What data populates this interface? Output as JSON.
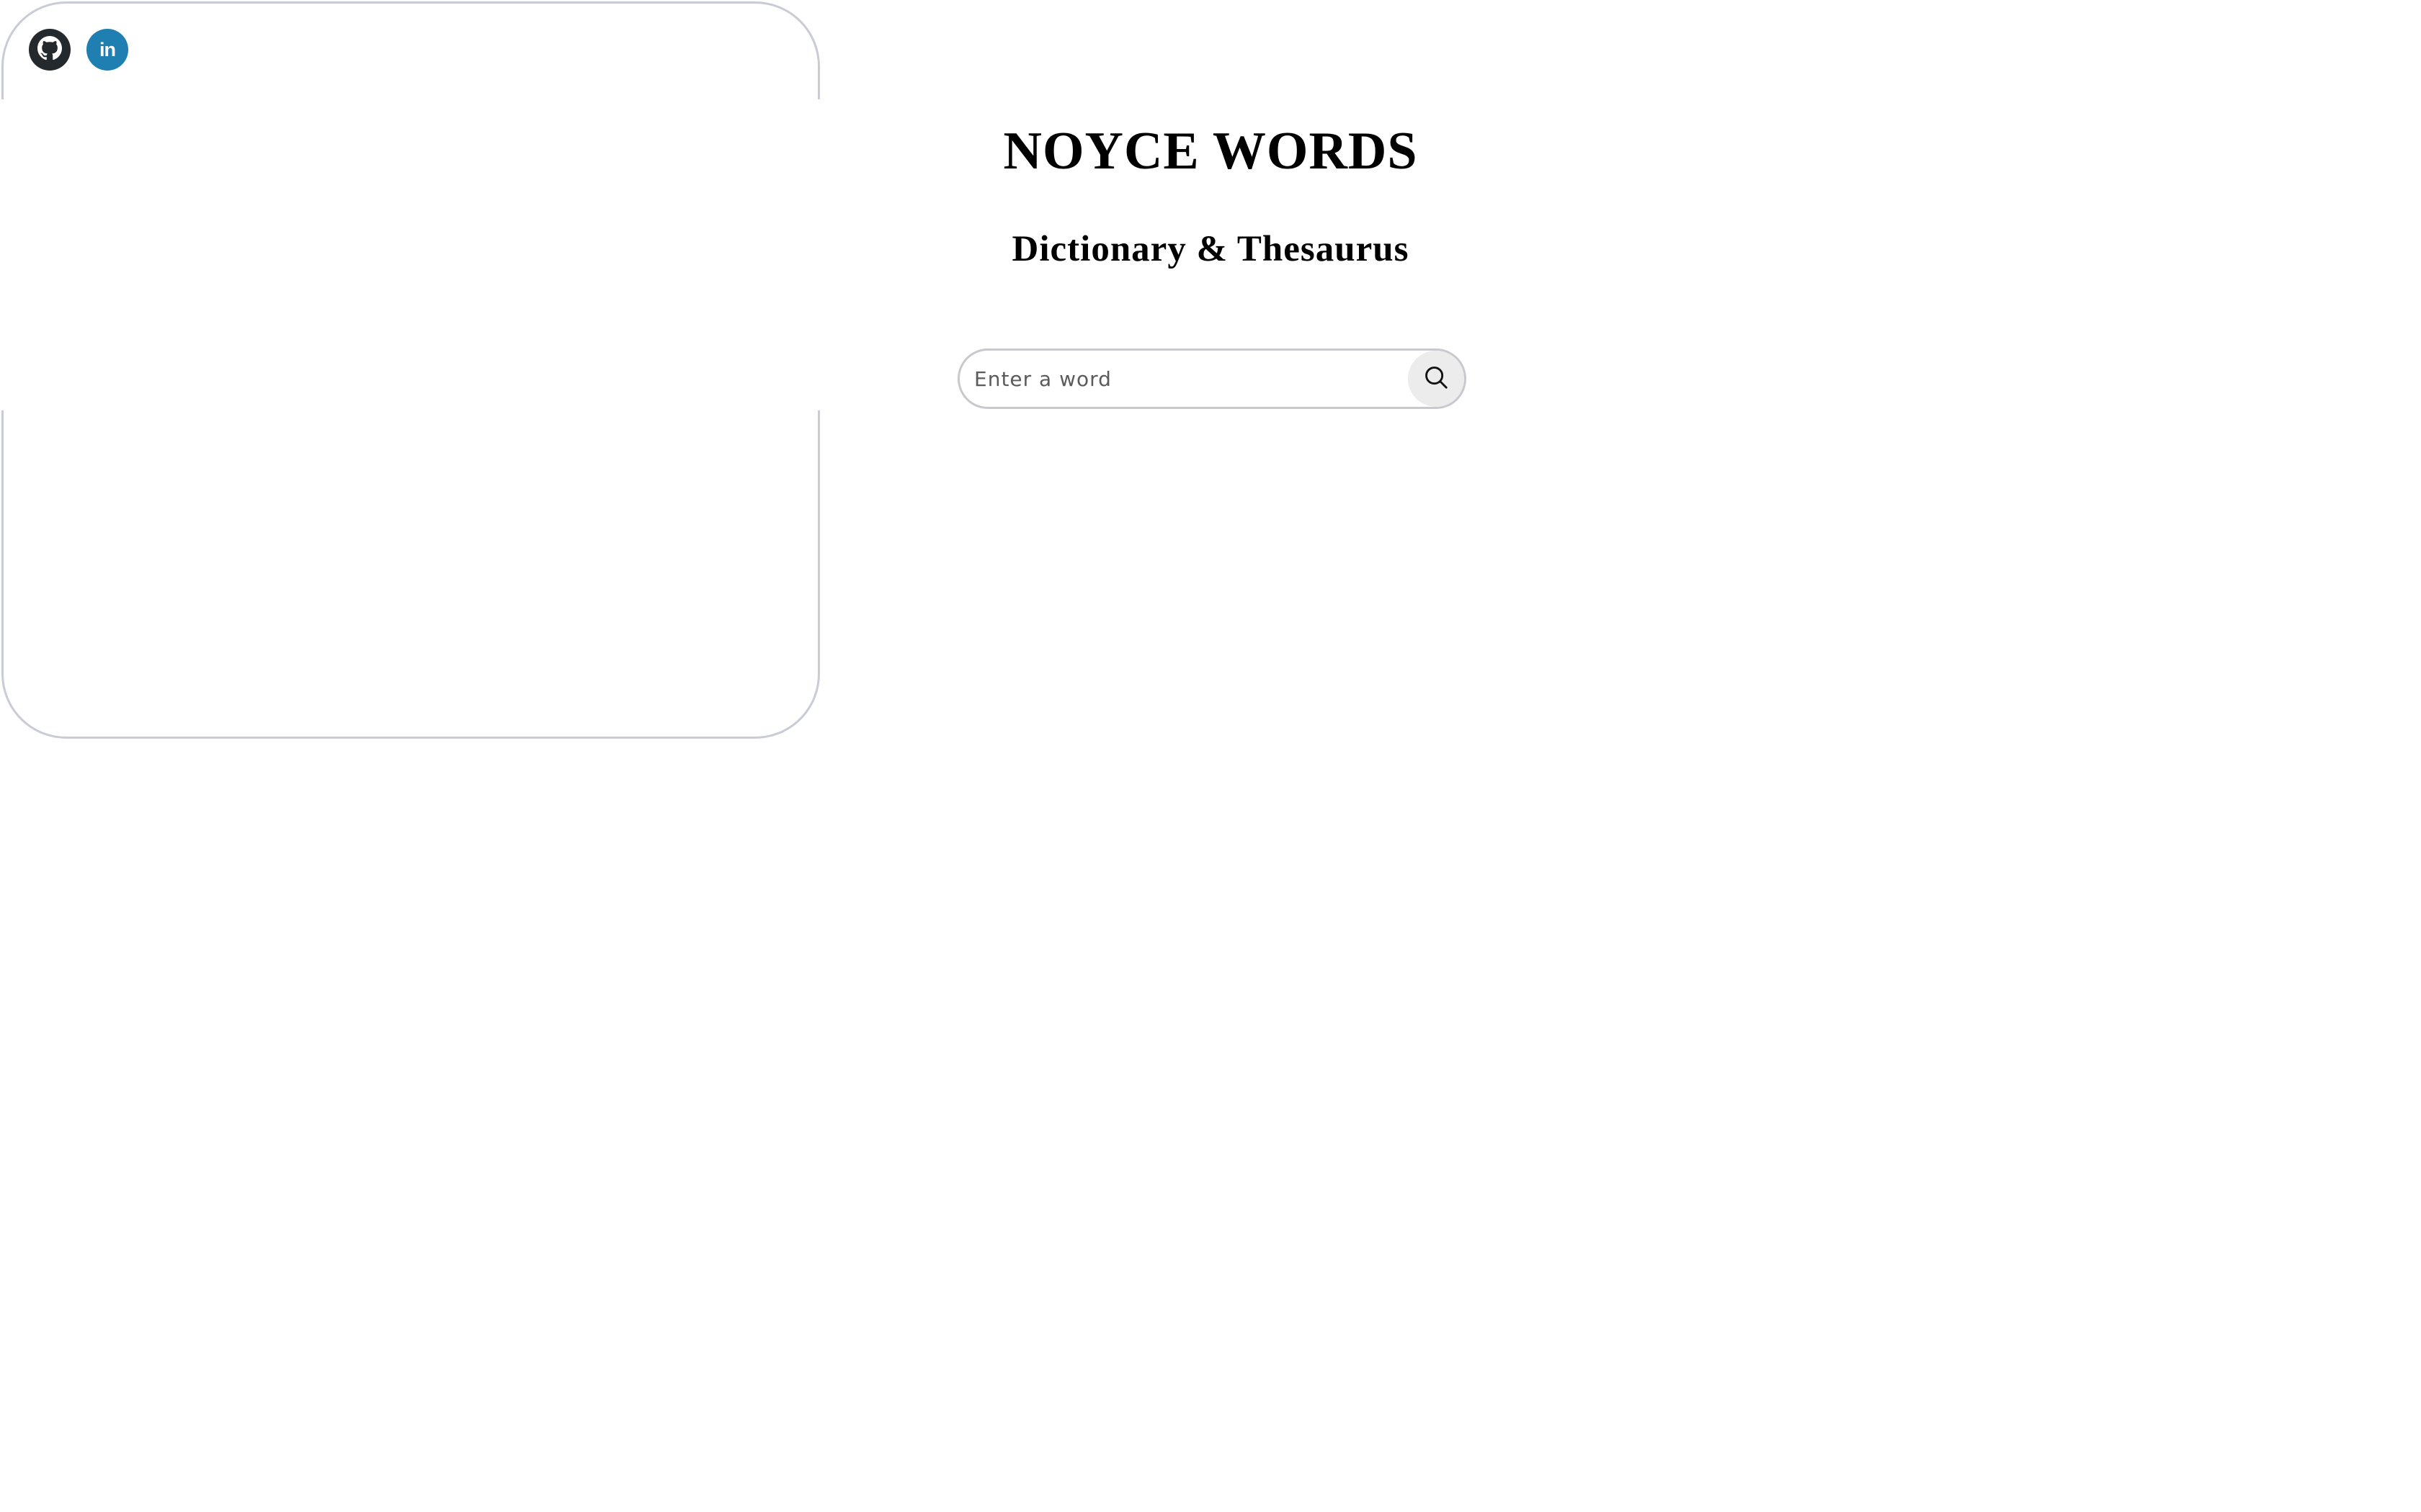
{
  "social": {
    "github_icon": "github-icon",
    "linkedin_icon": "linkedin-icon",
    "linkedin_glyph": "in"
  },
  "header": {
    "title": "NOYCE WORDS",
    "subtitle": "Dictionary & Thesaurus"
  },
  "search": {
    "value": "",
    "placeholder": "Enter a word",
    "button_icon": "search-icon"
  },
  "colors": {
    "github": "#24292e",
    "linkedin": "#1f7fb0",
    "search_button_bg": "#ececec",
    "outline": "#c9ccd6"
  }
}
